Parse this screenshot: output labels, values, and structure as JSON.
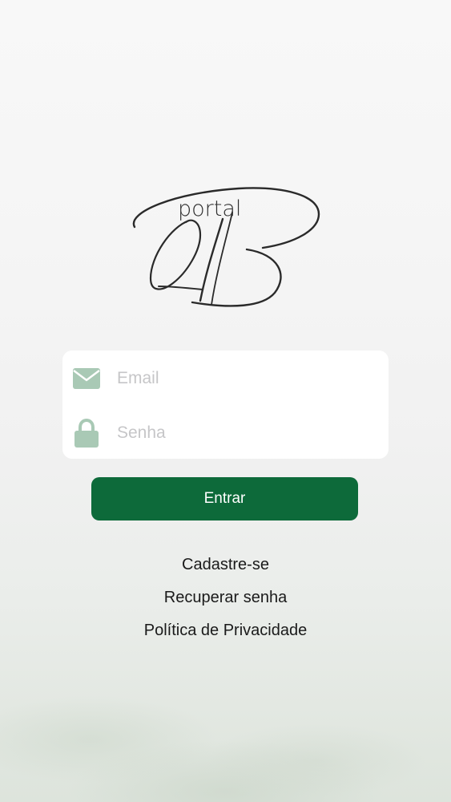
{
  "app": {
    "logo_text": "portal",
    "logo_mark": "QB"
  },
  "form": {
    "email": {
      "icon": "mail-icon",
      "placeholder": "Email",
      "value": ""
    },
    "password": {
      "icon": "lock-icon",
      "placeholder": "Senha",
      "value": ""
    },
    "submit_label": "Entrar"
  },
  "links": {
    "register": "Cadastre-se",
    "recover_password": "Recuperar senha",
    "privacy_policy": "Política de Privacidade"
  },
  "colors": {
    "primary": "#0d6a3a",
    "icon_tint": "#a9c9b5",
    "placeholder": "#c6c6c8"
  }
}
